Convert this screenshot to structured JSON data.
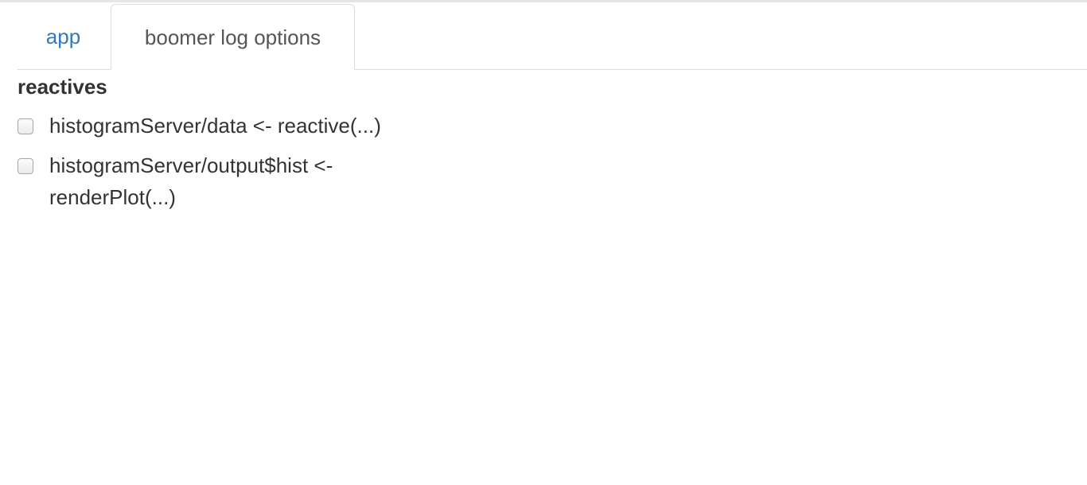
{
  "tabs": [
    {
      "label": "app",
      "active": false
    },
    {
      "label": "boomer log options",
      "active": true
    }
  ],
  "section": {
    "title": "reactives"
  },
  "options": [
    {
      "label": "histogramServer/data <- reactive(...)",
      "checked": false
    },
    {
      "label": "histogramServer/output$hist <- renderPlot(...)",
      "checked": false
    }
  ],
  "colors": {
    "link": "#337ab7",
    "text": "#333333",
    "border": "#dddddd"
  }
}
